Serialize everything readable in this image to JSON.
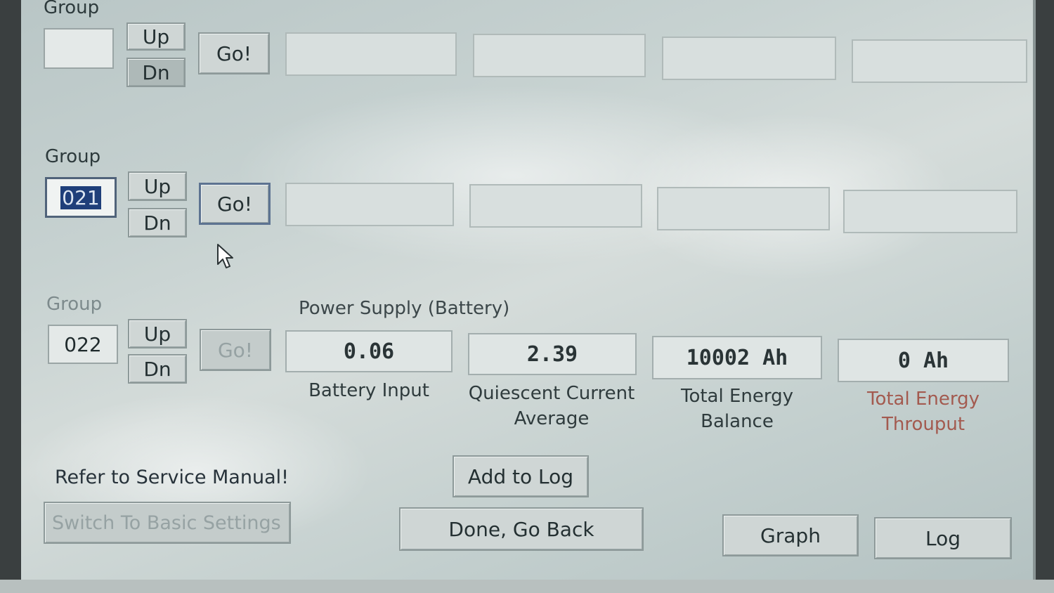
{
  "rows": [
    {
      "group_label": "Group",
      "group_value": "",
      "up_label": "Up",
      "dn_label": "Dn",
      "go_label": "Go!"
    },
    {
      "group_label": "Group",
      "group_value": "021",
      "up_label": "Up",
      "dn_label": "Dn",
      "go_label": "Go!"
    },
    {
      "group_label": "Group",
      "group_value": "022",
      "up_label": "Up",
      "dn_label": "Dn",
      "go_label": "Go!"
    }
  ],
  "power_supply": {
    "section_title": "Power Supply (Battery)",
    "readouts": [
      {
        "value": "0.06",
        "caption_line1": "Battery Input",
        "caption_line2": ""
      },
      {
        "value": "2.39",
        "caption_line1": "Quiescent Current",
        "caption_line2": "Average"
      },
      {
        "value": "10002 Ah",
        "caption_line1": "Total Energy",
        "caption_line2": "Balance"
      },
      {
        "value": "0 Ah",
        "caption_line1": "Total Energy",
        "caption_line2": "Throuput"
      }
    ]
  },
  "footer": {
    "notice": "Refer to Service Manual!",
    "switch_basic_label": "Switch To Basic Settings",
    "add_to_log_label": "Add to Log",
    "done_go_back_label": "Done, Go Back",
    "graph_label": "Graph",
    "log_label": "Log"
  },
  "colors": {
    "selection": "#1f3f7a",
    "panel": "#c7d2d1",
    "faded_caption": "#a35a4f"
  }
}
